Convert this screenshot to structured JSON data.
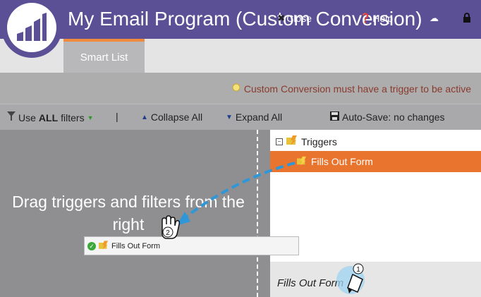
{
  "header": {
    "title": "My Email Program (Custom Conversion)",
    "actions": [
      {
        "icon": "close-icon",
        "label": "Close"
      },
      {
        "icon": "help-icon",
        "label": "Help"
      },
      {
        "icon": "cloud-icon",
        "label": ""
      },
      {
        "icon": "lock-icon",
        "label": ""
      }
    ]
  },
  "tabs": [
    {
      "label": "Smart List",
      "active": true
    }
  ],
  "warning": {
    "icon": "lightbulb-icon",
    "text": "Custom Conversion must have a trigger to be active"
  },
  "toolbar": {
    "use_prefix": "Use",
    "use_all": "ALL",
    "use_suffix": "filters",
    "separator": "|",
    "collapse_all": "Collapse All",
    "expand_all": "Expand All",
    "autosave": "Auto-Save: no changes"
  },
  "drop_area": {
    "text_line1": "Drag triggers and filters from the",
    "text_line2": "right"
  },
  "tree": {
    "root_label": "Triggers",
    "selected_item": "Fills Out Form"
  },
  "bottom_panel": {
    "label": "Fills Out Form"
  },
  "drag_item": {
    "label": "Fills Out Form"
  },
  "annotations": {
    "step1": "1",
    "step2": "2"
  },
  "colors": {
    "header": "#5b4f96",
    "tab_accent": "#f08a3c",
    "selected": "#e8742d",
    "warning_text": "#8a3a2d",
    "arrow": "#2f96d8"
  }
}
